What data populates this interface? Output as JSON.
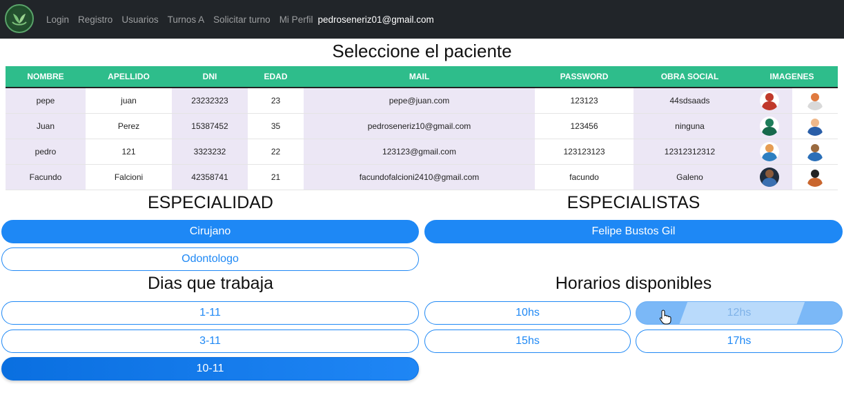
{
  "navbar": {
    "logo_icon": "leaf-hands-logo-icon",
    "links": [
      "Login",
      "Registro",
      "Usuarios",
      "Turnos A",
      "Solicitar turno",
      "Mi Perfil"
    ],
    "user_email": "pedroseneriz01@gmail.com"
  },
  "patients": {
    "title": "Seleccione el paciente",
    "headers": [
      "NOMBRE",
      "APELLIDO",
      "DNI",
      "EDAD",
      "MAIL",
      "PASSWORD",
      "OBRA SOCIAL",
      "IMAGENES"
    ],
    "rows": [
      {
        "nombre": "pepe",
        "apellido": "juan",
        "dni": "23232323",
        "edad": "23",
        "mail": "pepe@juan.com",
        "password": "123123",
        "obra_social": "44sdsaads",
        "images": [
          "superhero-avatar-icon",
          "nurse-avatar-icon"
        ]
      },
      {
        "nombre": "Juan",
        "apellido": "Perez",
        "dni": "15387452",
        "edad": "35",
        "mail": "pedroseneriz10@gmail.com",
        "password": "123456",
        "obra_social": "ninguna",
        "images": [
          "ninja-avatar-icon",
          "businessman-avatar-icon"
        ]
      },
      {
        "nombre": "pedro",
        "apellido": "121",
        "dni": "3323232",
        "edad": "22",
        "mail": "123123@gmail.com",
        "password": "123123123",
        "obra_social": "12312312312",
        "images": [
          "worker-avatar-icon",
          "police-avatar-icon"
        ]
      },
      {
        "nombre": "Facundo",
        "apellido": "Falcioni",
        "dni": "42358741",
        "edad": "21",
        "mail": "facundofalcioni2410@gmail.com",
        "password": "facundo",
        "obra_social": "Galeno",
        "images": [
          "dark-avatar-icon",
          "helmet-avatar-icon"
        ]
      }
    ]
  },
  "especialidad": {
    "title": "ESPECIALIDAD",
    "options": [
      "Cirujano",
      "Odontologo"
    ],
    "selected": "Cirujano"
  },
  "especialistas": {
    "title": "ESPECIALISTAS",
    "options": [
      "Felipe Bustos Gil"
    ],
    "selected": "Felipe Bustos Gil"
  },
  "dias": {
    "title": "Dias que trabaja",
    "options": [
      "1-11",
      "3-11",
      "10-11"
    ],
    "selected": "10-11"
  },
  "horarios": {
    "title": "Horarios disponibles",
    "options": [
      "10hs",
      "12hs",
      "15hs",
      "17hs"
    ],
    "hovered": "12hs"
  },
  "colors": {
    "navbar": "#212529",
    "table_header": "#2ebd8b",
    "primary": "#1e88f5",
    "row_alt": "#ece7f5"
  }
}
